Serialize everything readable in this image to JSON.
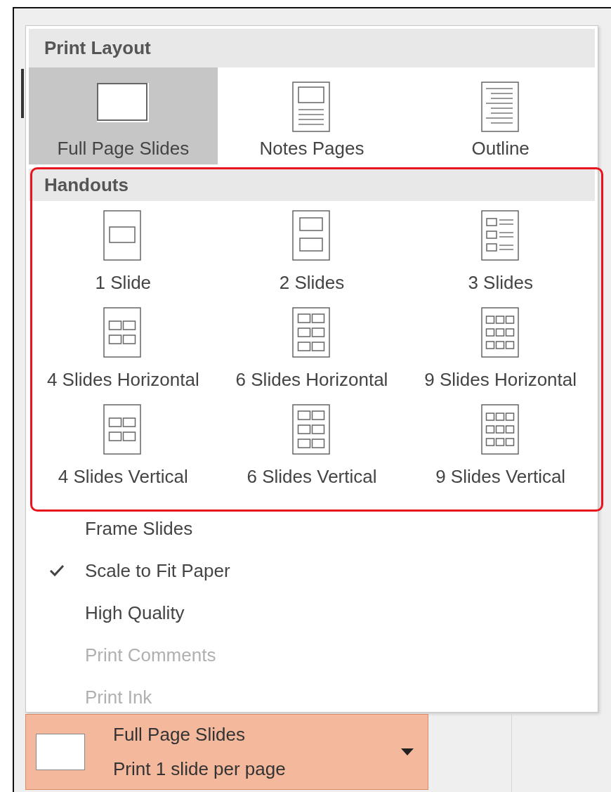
{
  "print_layout": {
    "title": "Print Layout",
    "items": [
      {
        "label": "Full Page Slides",
        "kind": "full",
        "selected": true
      },
      {
        "label": "Notes Pages",
        "kind": "notes",
        "selected": false
      },
      {
        "label": "Outline",
        "kind": "outline",
        "selected": false
      }
    ]
  },
  "handouts": {
    "title": "Handouts",
    "highlighted": true,
    "items": [
      {
        "label": "1 Slide",
        "kind": "h1",
        "selected": false
      },
      {
        "label": "2 Slides",
        "kind": "h2",
        "selected": false
      },
      {
        "label": "3 Slides",
        "kind": "h3",
        "selected": false
      },
      {
        "label": "4 Slides Horizontal",
        "kind": "h4",
        "selected": false
      },
      {
        "label": "6 Slides Horizontal",
        "kind": "h6",
        "selected": false
      },
      {
        "label": "9 Slides Horizontal",
        "kind": "h9",
        "selected": false
      },
      {
        "label": "4 Slides Vertical",
        "kind": "h4",
        "selected": false
      },
      {
        "label": "6 Slides Vertical",
        "kind": "h6",
        "selected": false
      },
      {
        "label": "9 Slides Vertical",
        "kind": "h9",
        "selected": false
      }
    ]
  },
  "options": [
    {
      "label": "Frame Slides",
      "checked": false,
      "disabled": false
    },
    {
      "label": "Scale to Fit Paper",
      "checked": true,
      "disabled": false
    },
    {
      "label": "High Quality",
      "checked": false,
      "disabled": false
    },
    {
      "label": "Print Comments",
      "checked": false,
      "disabled": true
    },
    {
      "label": "Print Ink",
      "checked": false,
      "disabled": true
    }
  ],
  "dropdown": {
    "title": "Full Page Slides",
    "subtitle": "Print 1 slide per page"
  }
}
